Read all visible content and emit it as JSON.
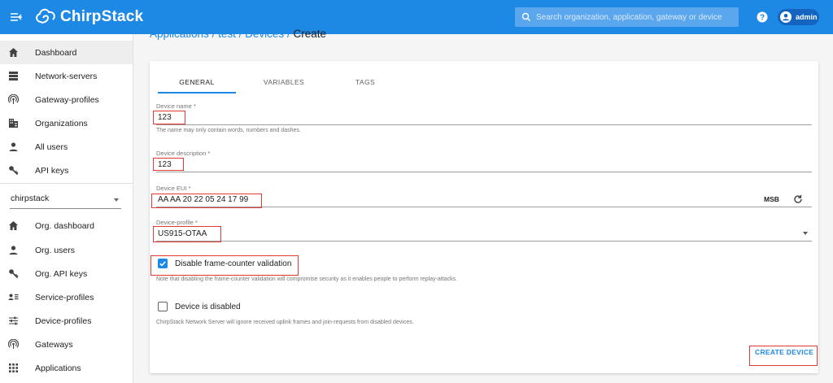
{
  "topbar": {
    "brand": "ChirpStack",
    "search_placeholder": "Search organization, application, gateway or device",
    "user": "admin"
  },
  "sidebar": {
    "admin_items": [
      {
        "label": "Dashboard",
        "icon": "home-icon"
      },
      {
        "label": "Network-servers",
        "icon": "server-icon"
      },
      {
        "label": "Gateway-profiles",
        "icon": "radio-tower-icon"
      },
      {
        "label": "Organizations",
        "icon": "building-icon"
      },
      {
        "label": "All users",
        "icon": "person-icon"
      },
      {
        "label": "API keys",
        "icon": "key-icon"
      }
    ],
    "organization": "chirpstack",
    "org_items": [
      {
        "label": "Org. dashboard",
        "icon": "home-icon"
      },
      {
        "label": "Org. users",
        "icon": "person-icon"
      },
      {
        "label": "Org. API keys",
        "icon": "key-icon"
      },
      {
        "label": "Service-profiles",
        "icon": "contact-list-icon"
      },
      {
        "label": "Device-profiles",
        "icon": "tune-icon"
      },
      {
        "label": "Gateways",
        "icon": "radio-tower-icon"
      },
      {
        "label": "Applications",
        "icon": "apps-grid-icon"
      }
    ]
  },
  "breadcrumb": {
    "items": [
      "Applications",
      "test",
      "Devices"
    ],
    "separator": "/",
    "current": "Create"
  },
  "tabs": [
    "GENERAL",
    "VARIABLES",
    "TAGS"
  ],
  "form": {
    "device_name": {
      "label": "Device name *",
      "value": "123",
      "helper": "The name may only contain words, numbers and dashes."
    },
    "device_description": {
      "label": "Device description *",
      "value": "123"
    },
    "device_eui": {
      "label": "Device EUI *",
      "value": "AA AA 20 22 05 24 17 99",
      "byte_order": "MSB"
    },
    "device_profile": {
      "label": "Device-profile *",
      "value": "US915-OTAA"
    },
    "disable_fcnt": {
      "label": "Disable frame-counter validation",
      "checked": true,
      "note": "Note that disabling the frame-counter validation will compromise security as it enables people to perform replay-attacks."
    },
    "device_disabled": {
      "label": "Device is disabled",
      "checked": false,
      "note": "ChirpStack Network Server will ignore received uplink frames and join-requests from disabled devices."
    }
  },
  "actions": {
    "create_label": "CREATE DEVICE"
  },
  "colors": {
    "primary": "#1e88e5",
    "highlight": "#e53935"
  }
}
